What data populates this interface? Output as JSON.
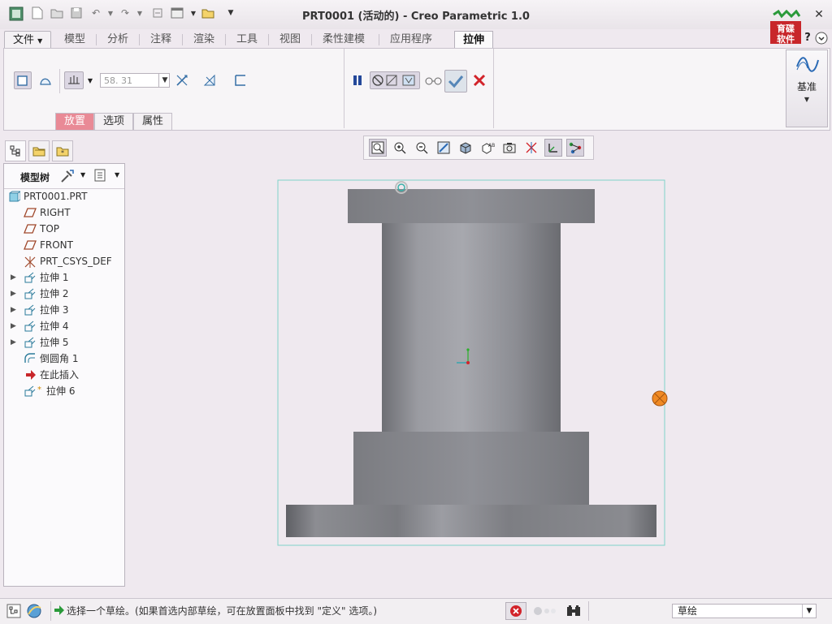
{
  "window": {
    "title": "PRT0001 (活动的) - Creo Parametric 1.0",
    "logo_text_1": "育碟",
    "logo_text_2": "软件"
  },
  "ribbon_tabs": [
    {
      "label": "文件"
    },
    {
      "label": "模型"
    },
    {
      "label": "分析"
    },
    {
      "label": "注释"
    },
    {
      "label": "渲染"
    },
    {
      "label": "工具"
    },
    {
      "label": "视图"
    },
    {
      "label": "柔性建模"
    },
    {
      "label": "应用程序"
    },
    {
      "label": "拉伸"
    }
  ],
  "extrude": {
    "depth_value": "58. 31",
    "subtabs": [
      {
        "label": "放置"
      },
      {
        "label": "选项"
      },
      {
        "label": "属性"
      }
    ],
    "datum_label": "基准"
  },
  "model_tree": {
    "title": "模型树",
    "items": [
      {
        "label": "PRT0001.PRT",
        "icon": "part-icon"
      },
      {
        "label": "RIGHT",
        "icon": "datum-plane-icon"
      },
      {
        "label": "TOP",
        "icon": "datum-plane-icon"
      },
      {
        "label": "FRONT",
        "icon": "datum-plane-icon"
      },
      {
        "label": "PRT_CSYS_DEF",
        "icon": "csys-icon"
      },
      {
        "label": "拉伸 1",
        "icon": "extrude-icon"
      },
      {
        "label": "拉伸 2",
        "icon": "extrude-icon"
      },
      {
        "label": "拉伸 3",
        "icon": "extrude-icon"
      },
      {
        "label": "拉伸 4",
        "icon": "extrude-icon"
      },
      {
        "label": "拉伸 5",
        "icon": "extrude-icon"
      },
      {
        "label": "倒圆角 1",
        "icon": "round-icon"
      },
      {
        "label": "在此插入",
        "icon": "insert-arrow-icon"
      },
      {
        "label": "拉伸 6",
        "icon": "extrude-new-icon"
      }
    ]
  },
  "status": {
    "message": "选择一个草绘。(如果首选内部草绘，可在放置面板中找到 \"定义\" 选项。)",
    "filter": "草绘"
  },
  "colors": {
    "accent_tab": "#e98a96",
    "model_body": "#8c8d92",
    "background": "#efe9ef"
  }
}
